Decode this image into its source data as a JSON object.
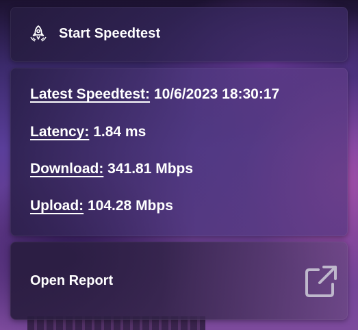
{
  "start": {
    "icon": "rocket-speedtest-icon",
    "label": "Start Speedtest"
  },
  "stats": [
    {
      "key": "Latest Speedtest:",
      "value": "10/6/2023 18:30:17"
    },
    {
      "key": "Latency:",
      "value": "1.84 ms"
    },
    {
      "key": "Download:",
      "value": "341.81 Mbps"
    },
    {
      "key": "Upload:",
      "value": "104.28 Mbps"
    }
  ],
  "report": {
    "label": "Open Report",
    "icon": "external-link-icon"
  },
  "colors": {
    "text": "#ffffff",
    "icon_muted": "#bfb8cc"
  }
}
